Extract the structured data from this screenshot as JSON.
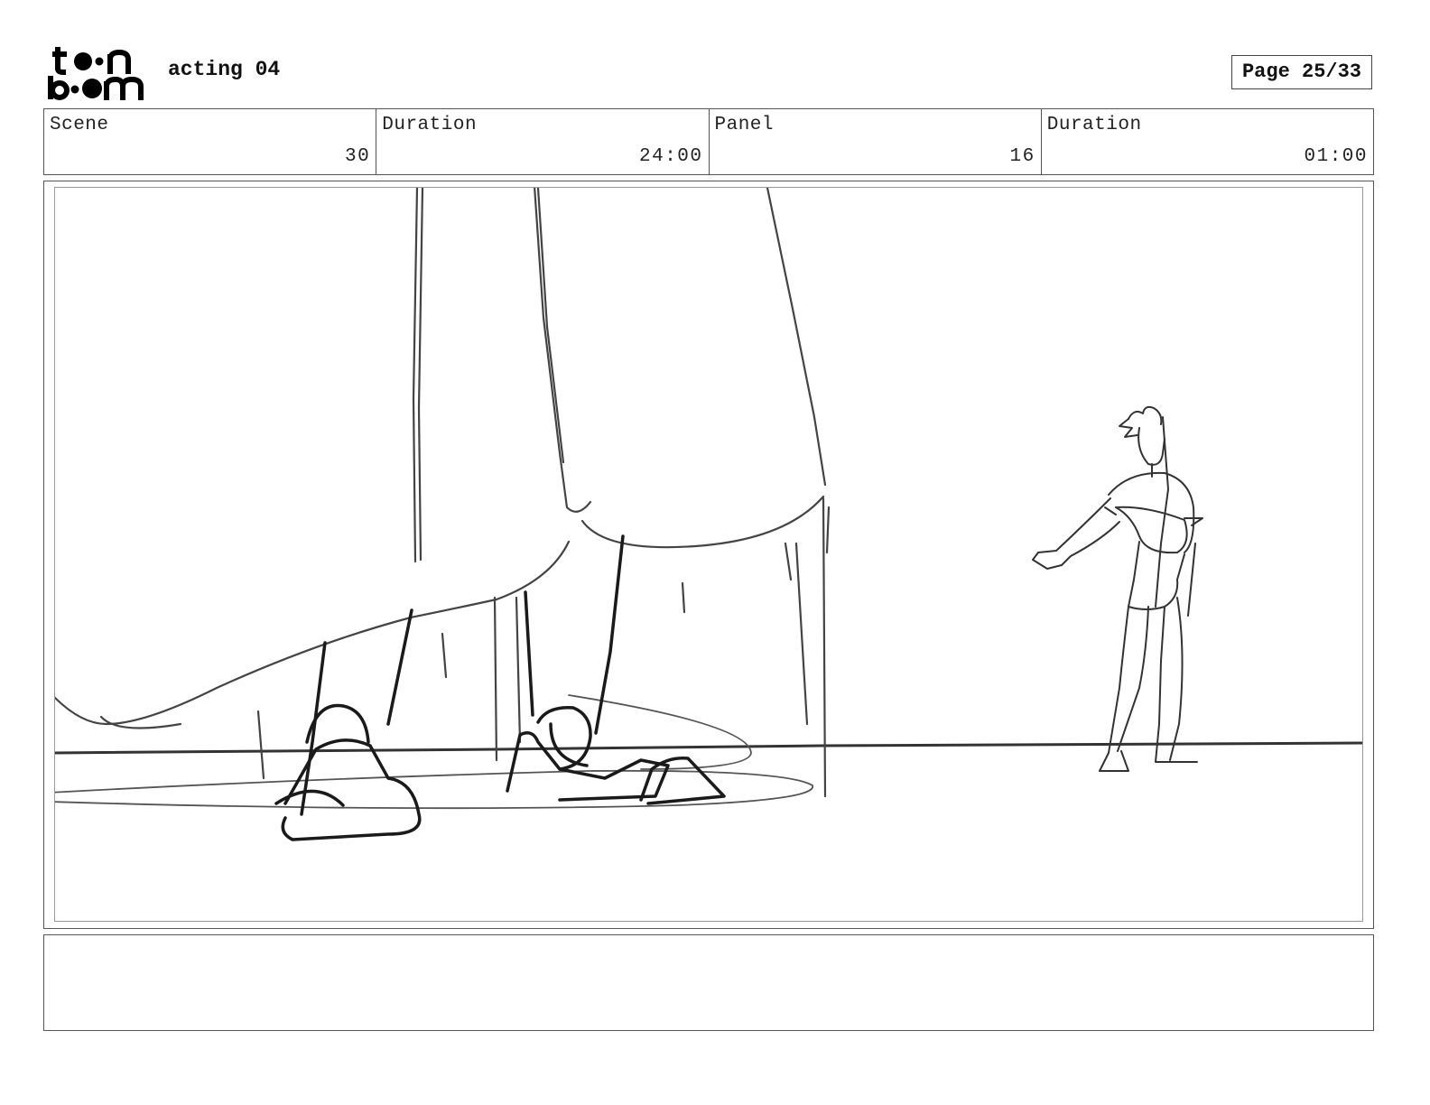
{
  "header": {
    "logo_text": "toon boom",
    "project_title": "acting 04",
    "page_label": "Page 25/33"
  },
  "info": {
    "scene_label": "Scene",
    "scene_value": "30",
    "scene_duration_label": "Duration",
    "scene_duration_value": "24:00",
    "panel_label": "Panel",
    "panel_value": "16",
    "panel_duration_label": "Duration",
    "panel_duration_value": "01:00"
  },
  "notes": {
    "text": ""
  }
}
